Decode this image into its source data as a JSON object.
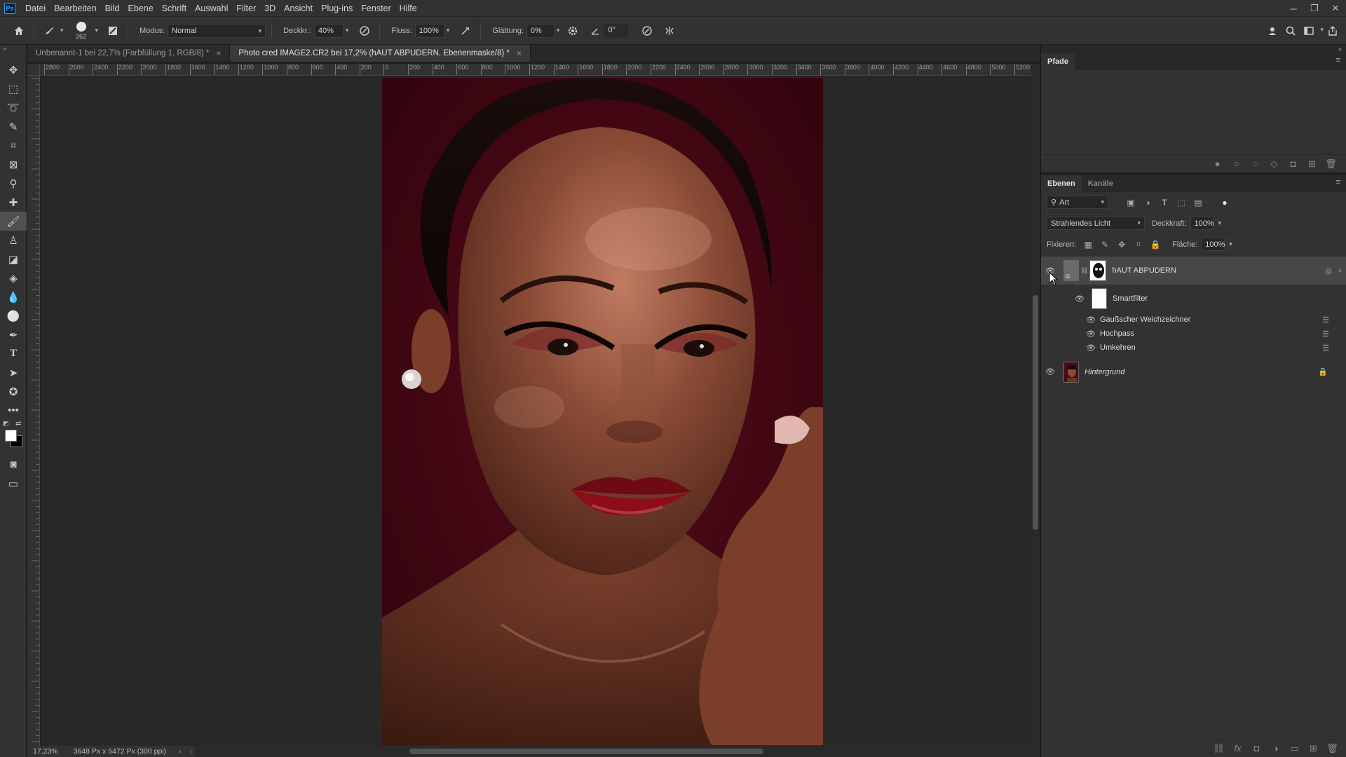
{
  "menubar": {
    "logo": "Ps",
    "items": [
      "Datei",
      "Bearbeiten",
      "Bild",
      "Ebene",
      "Schrift",
      "Auswahl",
      "Filter",
      "3D",
      "Ansicht",
      "Plug-ins",
      "Fenster",
      "Hilfe"
    ],
    "window_controls": [
      "minimize-icon",
      "restore-icon",
      "close-icon"
    ]
  },
  "options": {
    "brush_size": "262",
    "mode_label": "Modus:",
    "mode_value": "Normal",
    "opacity_label": "Deckkr.:",
    "opacity_value": "40%",
    "flow_label": "Fluss:",
    "flow_value": "100%",
    "smoothing_label": "Glättung:",
    "smoothing_value": "0%",
    "angle_value": "0°"
  },
  "tabs": [
    {
      "title": "Unbenannt-1 bei 22,7% (Farbfüllung 1, RGB/8) *",
      "active": false
    },
    {
      "title": "Photo cred IMAGE2.CR2 bei 17,2% (hAUT ABPUDERN, Ebenenmaske/8) *",
      "active": true
    }
  ],
  "ruler_top": [
    "2800",
    "2600",
    "2400",
    "2200",
    "2000",
    "1800",
    "1600",
    "1400",
    "1200",
    "1000",
    "800",
    "600",
    "400",
    "200",
    "0",
    "200",
    "400",
    "600",
    "800",
    "1000",
    "1200",
    "1400",
    "1600",
    "1800",
    "2000",
    "2200",
    "2400",
    "2600",
    "2800",
    "3000",
    "3200",
    "3400",
    "3600",
    "3800",
    "4000",
    "4200",
    "4400",
    "4600",
    "4800",
    "5000",
    "5200"
  ],
  "status": {
    "zoom": "17,23%",
    "doc_info": "3648 Px x 5472 Px (300 ppi)"
  },
  "paths_panel": {
    "tab": "Pfade"
  },
  "layers_panel": {
    "tabs": [
      "Ebenen",
      "Kanäle"
    ],
    "filter_kind": "Art",
    "blend_mode": "Strahlendes Licht",
    "opacity_label": "Deckkraft:",
    "opacity_value": "100%",
    "lock_label": "Fixieren:",
    "fill_label": "Fläche:",
    "fill_value": "100%",
    "layers": [
      {
        "name": "hAUT ABPUDERN",
        "visible": true,
        "selected": true
      },
      {
        "name": "Smartfilter",
        "visible": true
      },
      {
        "name": "Gaußscher Weichzeichner",
        "visible": true
      },
      {
        "name": "Hochpass",
        "visible": true
      },
      {
        "name": "Umkehren",
        "visible": true
      },
      {
        "name": "Hintergrund",
        "visible": true,
        "locked": true
      }
    ]
  },
  "colors": {
    "accent": "#31a8ff",
    "backdrop": "#3a0611",
    "foreground": "#ffffff",
    "background": "#000000"
  }
}
